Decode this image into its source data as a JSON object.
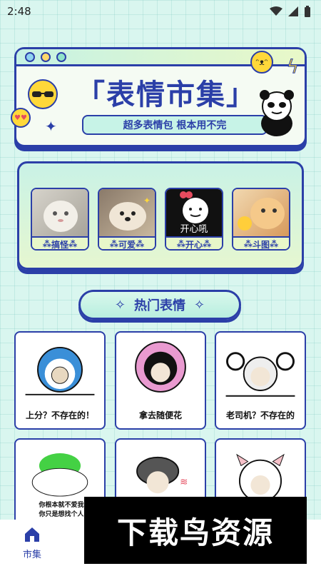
{
  "status_bar": {
    "time": "2:48"
  },
  "banner": {
    "title": "「表情市集」",
    "subtitle": "超多表情包 根本用不完"
  },
  "categories": [
    {
      "label": "搞怪",
      "icon": "cat-photo"
    },
    {
      "label": "可爱",
      "icon": "dog-photo"
    },
    {
      "label": "开心",
      "icon": "panda-face",
      "overlay_text": "开心吼"
    },
    {
      "label": "斗图",
      "icon": "cat-fist-photo"
    }
  ],
  "hot_section": {
    "title": "热门表情"
  },
  "memes": [
    {
      "caption": "上分？不存在的！",
      "icon": "doraemon-meme"
    },
    {
      "caption": "拿去随便花",
      "icon": "flower-meme"
    },
    {
      "caption": "老司机？不存在的",
      "icon": "ram-horn-meme"
    },
    {
      "caption": "你根本就不爱我\n你只是想找个人",
      "icon": "frog-hat-meme"
    },
    {
      "caption": "",
      "icon": "mushroom-hair-meme"
    },
    {
      "caption": "",
      "icon": "pig-meme"
    }
  ],
  "nav": {
    "market_label": "市集"
  },
  "watermark": {
    "text": "下载鸟资源"
  }
}
